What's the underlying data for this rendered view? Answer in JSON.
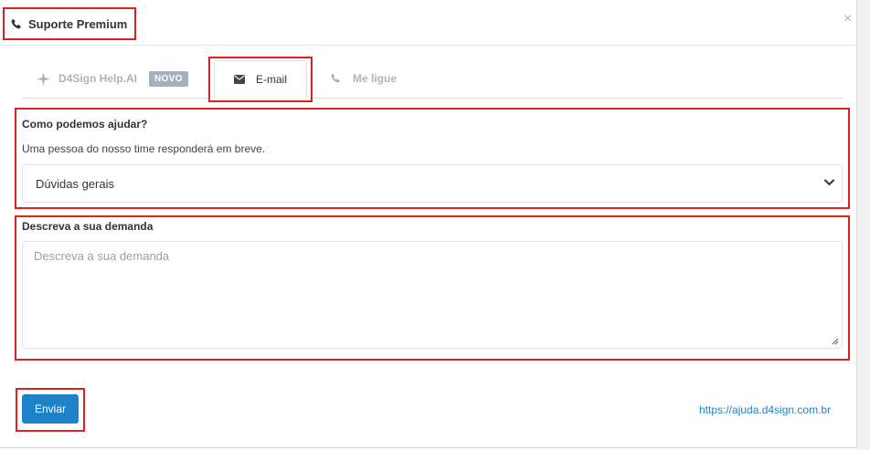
{
  "header": {
    "title": "Suporte Premium",
    "close_label": "×"
  },
  "tabs": [
    {
      "label": "D4Sign Help.AI",
      "badge": "NOVO",
      "icon": "sparkle-icon",
      "active": false
    },
    {
      "label": "E-mail",
      "icon": "envelope-icon",
      "active": true
    },
    {
      "label": "Me ligue",
      "icon": "phone-icon",
      "active": false
    }
  ],
  "form": {
    "help_label": "Como podemos ajudar?",
    "help_subtext": "Uma pessoa do nosso time responderá em breve.",
    "topic_selected": "Dúvidas gerais",
    "description_label": "Descreva a sua demanda",
    "description_placeholder": "Descreva a sua demanda",
    "description_value": ""
  },
  "footer": {
    "send_label": "Enviar",
    "help_link": "https://ajuda.d4sign.com.br"
  },
  "colors": {
    "accent": "#1e82c8",
    "highlight": "#e02020",
    "badge": "#a6afbd",
    "inactive_tab": "#a9b4c2"
  }
}
